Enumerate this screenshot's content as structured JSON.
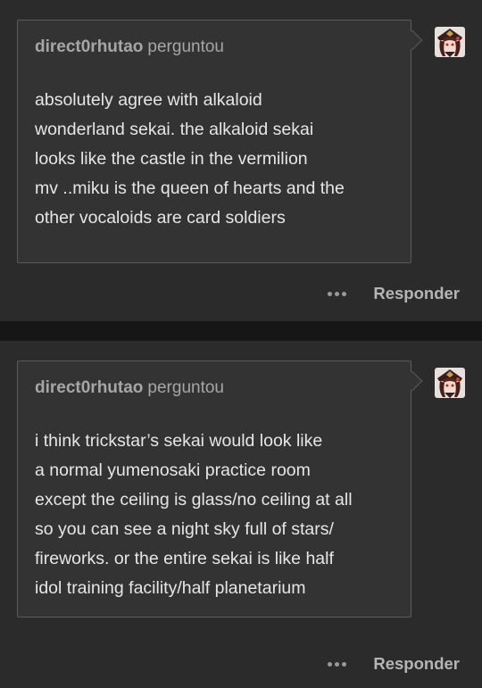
{
  "colors": {
    "page_background": "#161616",
    "post_background": "#2b2b2b",
    "ask_box_background": "#333333",
    "ask_box_border": "#5c5c5c",
    "header_text": "#a6a6a6",
    "body_text": "#e6e6e6"
  },
  "posts": [
    {
      "asker": "direct0rhutao",
      "verb": "perguntou",
      "question": "absolutely agree with alkaloid\nwonderland sekai. the alkaloid sekai\nlooks like the castle in the vermilion\nmv ..miku is the queen of hearts and the\nother vocaloids are card soldiers",
      "avatar_icon": "avatar-icon",
      "more_icon": "more-options-icon",
      "reply_label": "Responder"
    },
    {
      "asker": "direct0rhutao",
      "verb": "perguntou",
      "question": "i think trickstar’s sekai would look like\na normal yumenosaki practice room\nexcept the ceiling is glass/no ceiling at all\nso you can see a night sky full of stars/\nfireworks. or the entire sekai is like half\nidol training facility/half planetarium",
      "avatar_icon": "avatar-icon",
      "more_icon": "more-options-icon",
      "reply_label": "Responder"
    }
  ]
}
